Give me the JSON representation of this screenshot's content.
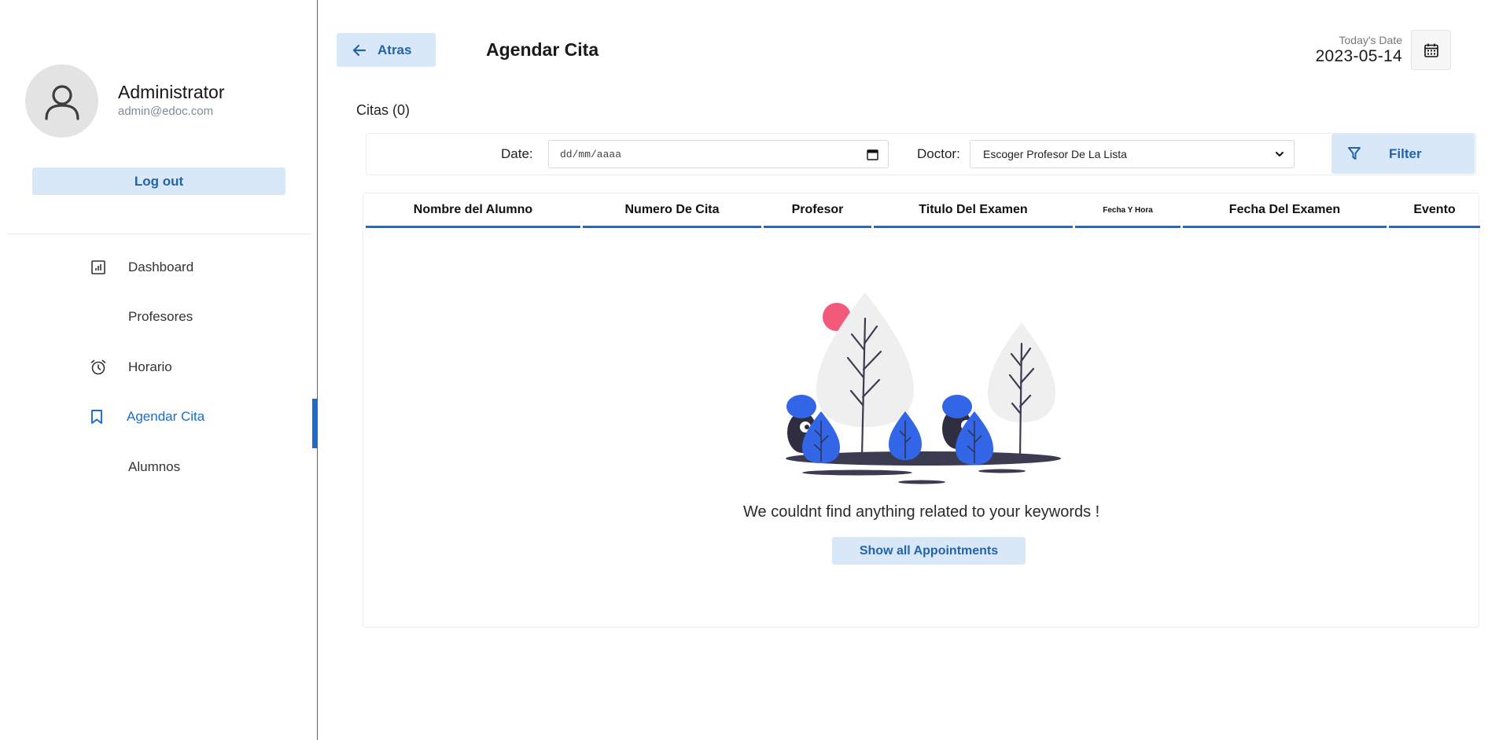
{
  "user": {
    "name": "Administrator",
    "email": "admin@edoc.com",
    "logout_label": "Log out"
  },
  "nav": {
    "items": [
      {
        "label": "Dashboard",
        "icon": "dashboard-icon"
      },
      {
        "label": "Profesores",
        "icon": ""
      },
      {
        "label": "Horario",
        "icon": "alarm-clock-icon"
      },
      {
        "label": "Agendar Cita",
        "icon": "bookmark-icon",
        "active": true
      },
      {
        "label": "Alumnos",
        "icon": ""
      }
    ]
  },
  "header": {
    "back_label": "Atras",
    "title": "Agendar Cita",
    "date_label": "Today's Date",
    "date_value": "2023-05-14"
  },
  "citas": {
    "title": "Citas (0)"
  },
  "filter": {
    "date_label": "Date:",
    "date_placeholder": "dd/mm/aaaa",
    "doctor_label": "Doctor:",
    "doctor_selected": "Escoger Profesor De La Lista",
    "button_label": "Filter"
  },
  "table": {
    "columns": [
      "Nombre del Alumno",
      "Numero De Cita",
      "Profesor",
      "Titulo Del Examen",
      "Fecha Y Hora",
      "Fecha Del Examen",
      "Evento"
    ]
  },
  "empty": {
    "message": "We couldnt find anything related to your keywords !",
    "button_label": "Show all Appointments"
  },
  "colors": {
    "accent": "#1c6cc8",
    "button_bg": "#d8e8f8",
    "button_text": "#2563a8",
    "illustration_blue": "#3366e6",
    "illustration_pink": "#f25a7a"
  }
}
